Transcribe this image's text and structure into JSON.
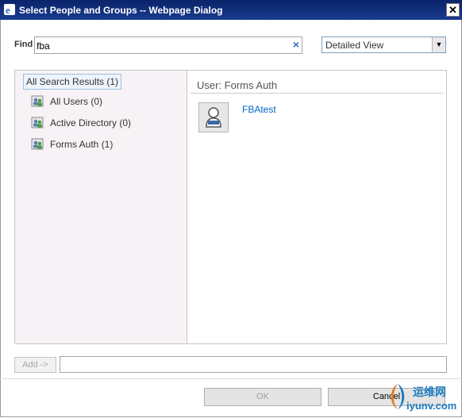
{
  "window": {
    "title": "Select People and Groups -- Webpage Dialog",
    "close_glyph": "✕"
  },
  "search": {
    "label": "Find",
    "value": "fba",
    "clear_glyph": "×"
  },
  "view": {
    "selected": "Detailed View",
    "arrow_glyph": "▼"
  },
  "tree": {
    "root": "All Search Results (1)",
    "items": [
      {
        "label": "All Users (0)",
        "icon": "users-icon"
      },
      {
        "label": "Active Directory (0)",
        "icon": "users-icon"
      },
      {
        "label": "Forms Auth (1)",
        "icon": "users-icon"
      }
    ]
  },
  "results": {
    "header": "User: Forms Auth",
    "items": [
      {
        "name": "FBAtest",
        "icon": "person-icon"
      }
    ]
  },
  "actions": {
    "add_label": "Add ->",
    "ok_label": "OK",
    "cancel_label": "Cancel"
  },
  "watermark": {
    "cn": "运维网",
    "en": "iyunv.com"
  },
  "colors": {
    "titlebar": "#0a246a",
    "link": "#0066cc",
    "left_pane_bg": "#f7f2f5"
  }
}
